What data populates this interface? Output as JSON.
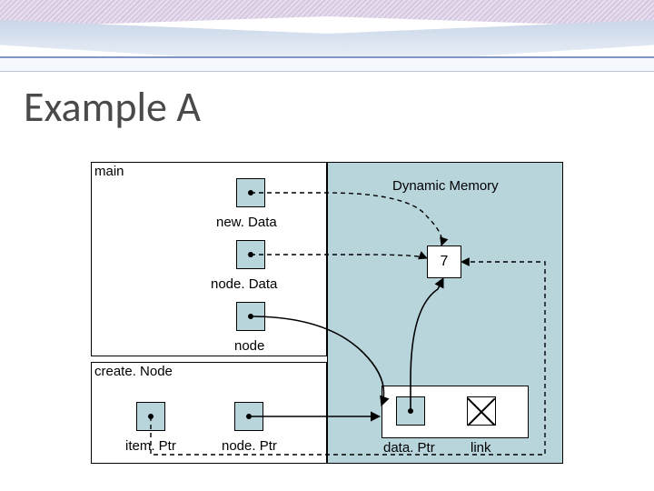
{
  "title": "Example A",
  "frames": {
    "main": "main",
    "create": "create. Node",
    "dynamic": "Dynamic Memory"
  },
  "vars": {
    "newData": "new. Data",
    "nodeData": "node. Data",
    "node": "node",
    "itemPtr": "item. Ptr",
    "nodePtr": "node. Ptr",
    "dataPtr": "data. Ptr",
    "link": "link"
  },
  "values": {
    "heapInt": "7"
  },
  "chart_data": {
    "type": "table",
    "title": "Linked-list createNode pointer diagram",
    "stack_frames": [
      {
        "name": "main",
        "slots": [
          {
            "var": "new. Data",
            "points_to": "heap_int_7",
            "style": "dashed"
          },
          {
            "var": "node. Data",
            "points_to": "heap_int_7",
            "style": "dashed"
          },
          {
            "var": "node",
            "points_to": "heap_node",
            "style": "solid"
          }
        ]
      },
      {
        "name": "create. Node",
        "slots": [
          {
            "var": "item. Ptr",
            "points_to": "heap_int_7",
            "style": "dashed"
          },
          {
            "var": "node. Ptr",
            "points_to": "heap_node",
            "style": "solid"
          }
        ]
      }
    ],
    "heap": [
      {
        "id": "heap_int_7",
        "kind": "int",
        "value": 7
      },
      {
        "id": "heap_node",
        "kind": "node",
        "fields": {
          "data. Ptr": "heap_int_7",
          "link": null
        }
      }
    ]
  }
}
